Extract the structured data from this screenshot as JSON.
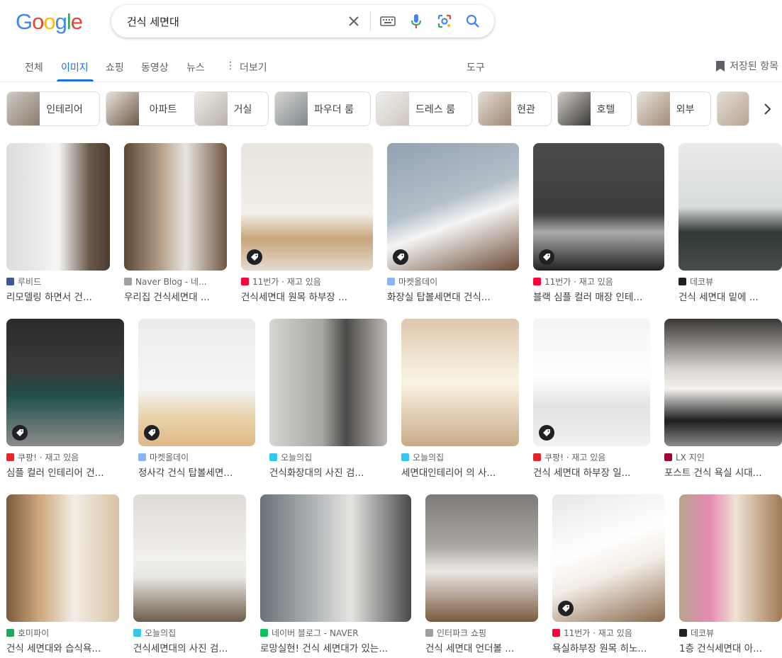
{
  "logo": {
    "letters": [
      "G",
      "o",
      "o",
      "g",
      "l",
      "e"
    ],
    "colors": [
      "#4285F4",
      "#EA4335",
      "#FBBC05",
      "#4285F4",
      "#34A853",
      "#EA4335"
    ]
  },
  "search": {
    "query": "건식 세면대"
  },
  "icons": {
    "clear": "close-icon",
    "keyboard": "keyboard-icon",
    "voice": "microphone-icon",
    "lens": "camera-lens-icon",
    "search": "search-icon"
  },
  "tabs": [
    {
      "label": "전체"
    },
    {
      "label": "이미지"
    },
    {
      "label": "쇼핑"
    },
    {
      "label": "동영상"
    },
    {
      "label": "뉴스"
    },
    {
      "label": "더보기"
    },
    {
      "label": "도구"
    }
  ],
  "saved_label": "저장된 항목",
  "accent": "#1a73e8",
  "chips": [
    {
      "label": "인테리어"
    },
    {
      "label": "아파트"
    },
    {
      "label": "거실"
    },
    {
      "label": "파우더 룸"
    },
    {
      "label": "드레스 룸"
    },
    {
      "label": "현관"
    },
    {
      "label": "호텔"
    },
    {
      "label": "외부"
    },
    {
      "label": ""
    }
  ],
  "results": [
    {
      "source": "루비드",
      "title": "리모델링 하면서 건...",
      "fav": "#3b5998",
      "tag": false
    },
    {
      "source": "Naver Blog - 네...",
      "title": "우리집 건식세면대 ...",
      "fav": "#9aa0a6",
      "tag": false
    },
    {
      "source": "11번가 · 재고 있음",
      "title": "건식세면대 원목 하부장 ...",
      "fav": "#ff0038",
      "tag": true
    },
    {
      "source": "마켓올데이",
      "title": "화장실 탑볼세면대 건식...",
      "fav": "#8ab4f8",
      "tag": true
    },
    {
      "source": "11번가 · 재고 있음",
      "title": "블랙 심플 컬러 매장 인테...",
      "fav": "#ff0038",
      "tag": true
    },
    {
      "source": "데코뷰",
      "title": "건식 세면대 밑에 ...",
      "fav": "#202124",
      "tag": false
    },
    {
      "source": "쿠팡! · 재고 있음",
      "title": "심플 컬러 인테리어 건...",
      "fav": "#e52528",
      "tag": true
    },
    {
      "source": "마켓올데이",
      "title": "정사각 건식 탑볼세면...",
      "fav": "#8ab4f8",
      "tag": true
    },
    {
      "source": "오늘의집",
      "title": "건식화장대의 사진 검...",
      "fav": "#35c5f0",
      "tag": false
    },
    {
      "source": "오늘의집",
      "title": "세면대인테리어 의 사...",
      "fav": "#35c5f0",
      "tag": false
    },
    {
      "source": "쿠팡! · 재고 있음",
      "title": "건식 세면대 하부장 일...",
      "fav": "#e52528",
      "tag": true
    },
    {
      "source": "LX 지인",
      "title": "포스트 건식 욕실 시대...",
      "fav": "#a50034",
      "tag": false
    },
    {
      "source": "호미파이",
      "title": "건식 세면대와 습식욕...",
      "fav": "#1aab5b",
      "tag": false
    },
    {
      "source": "오늘의집",
      "title": "건식세면대의 사진 검...",
      "fav": "#35c5f0",
      "tag": false
    },
    {
      "source": "네이버 블로그 - NAVER",
      "title": "로망실현! 건식 세면대가 있는...",
      "fav": "#03c75a",
      "tag": false
    },
    {
      "source": "인터파크 쇼핑",
      "title": "건식 세면대 언더볼 ...",
      "fav": "#9aa0a6",
      "tag": false
    },
    {
      "source": "11번가 · 재고 있음",
      "title": "욕실하부장 원목 히노...",
      "fav": "#ff0038",
      "tag": true
    },
    {
      "source": "데코뷰",
      "title": "1층 건식세면대 아...",
      "fav": "#202124",
      "tag": false
    }
  ]
}
